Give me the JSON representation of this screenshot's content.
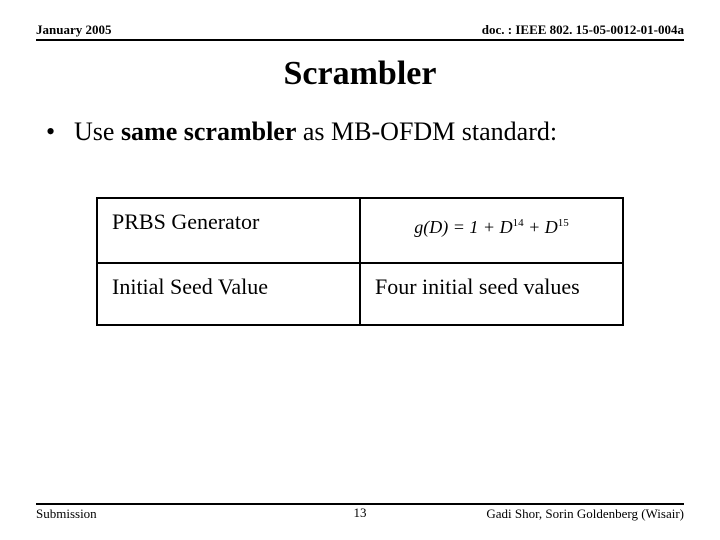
{
  "header": {
    "left": "January 2005",
    "right": "doc. : IEEE 802. 15-05-0012-01-004a"
  },
  "title": "Scrambler",
  "bullet": {
    "pre": "Use ",
    "strong": "same scrambler",
    "mid": " as ",
    "term": "MB-OFDM",
    "post": " standard:"
  },
  "table": {
    "r1c1": "PRBS Generator",
    "r1c2_formula_lhs": "g",
    "r1c2_formula_arg": "D",
    "r1c2_formula_rhs_a": "1",
    "r1c2_formula_rhs_b": "D",
    "r1c2_formula_exp1": "14",
    "r1c2_formula_rhs_c": "D",
    "r1c2_formula_exp2": "15",
    "r2c1": "Initial Seed Value",
    "r2c2": "Four initial seed values"
  },
  "footer": {
    "left": "Submission",
    "center": "13",
    "right": "Gadi Shor, Sorin Goldenberg (Wisair)"
  },
  "chart_data": {
    "type": "table",
    "rows": [
      {
        "label": "PRBS Generator",
        "value": "g(D) = 1 + D^14 + D^15"
      },
      {
        "label": "Initial Seed Value",
        "value": "Four initial seed values"
      }
    ]
  }
}
